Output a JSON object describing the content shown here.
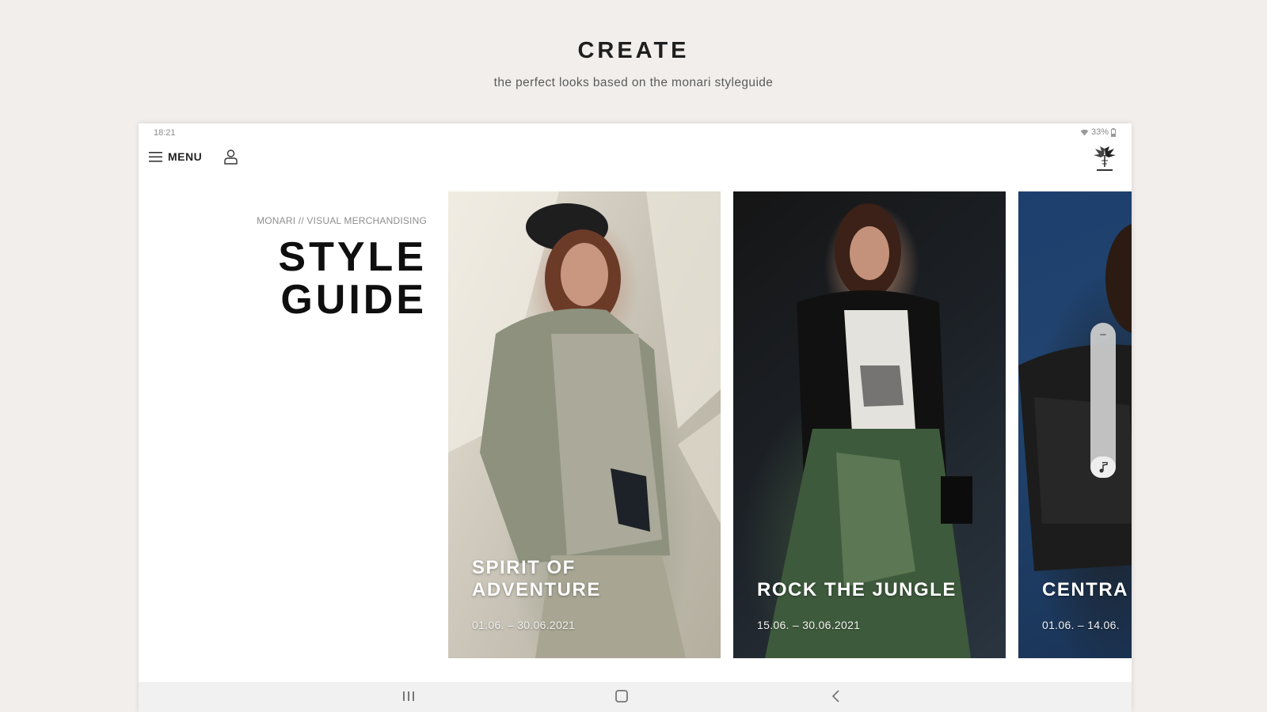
{
  "promo": {
    "title": "CREATE",
    "subtitle": "the perfect looks based on the monari styleguide"
  },
  "status_bar": {
    "time": "18:21",
    "battery": "33%"
  },
  "header": {
    "menu_label": "MENU",
    "menu_icon": "hamburger-icon",
    "user_icon": "user-icon",
    "logo_icon": "monari-logo-icon"
  },
  "page": {
    "breadcrumb": "MONARI // VISUAL MERCHANDISING",
    "title": "STYLE\nGUIDE"
  },
  "cards": [
    {
      "title": "SPIRIT OF\nADVENTURE",
      "date": "01.06. – 30.06.2021"
    },
    {
      "title": "ROCK THE JUNGLE",
      "date": "15.06. – 30.06.2021"
    },
    {
      "title": "CENTRA",
      "date": "01.06. – 14.06."
    }
  ],
  "volume_slider": {
    "level": 0.14,
    "icon": "music-note-icon"
  },
  "nav_bar": {
    "icons": [
      "recent-apps-icon",
      "home-icon",
      "back-icon"
    ]
  },
  "colors": {
    "background": "#f1eeeb",
    "text": "#1e1e1e"
  }
}
